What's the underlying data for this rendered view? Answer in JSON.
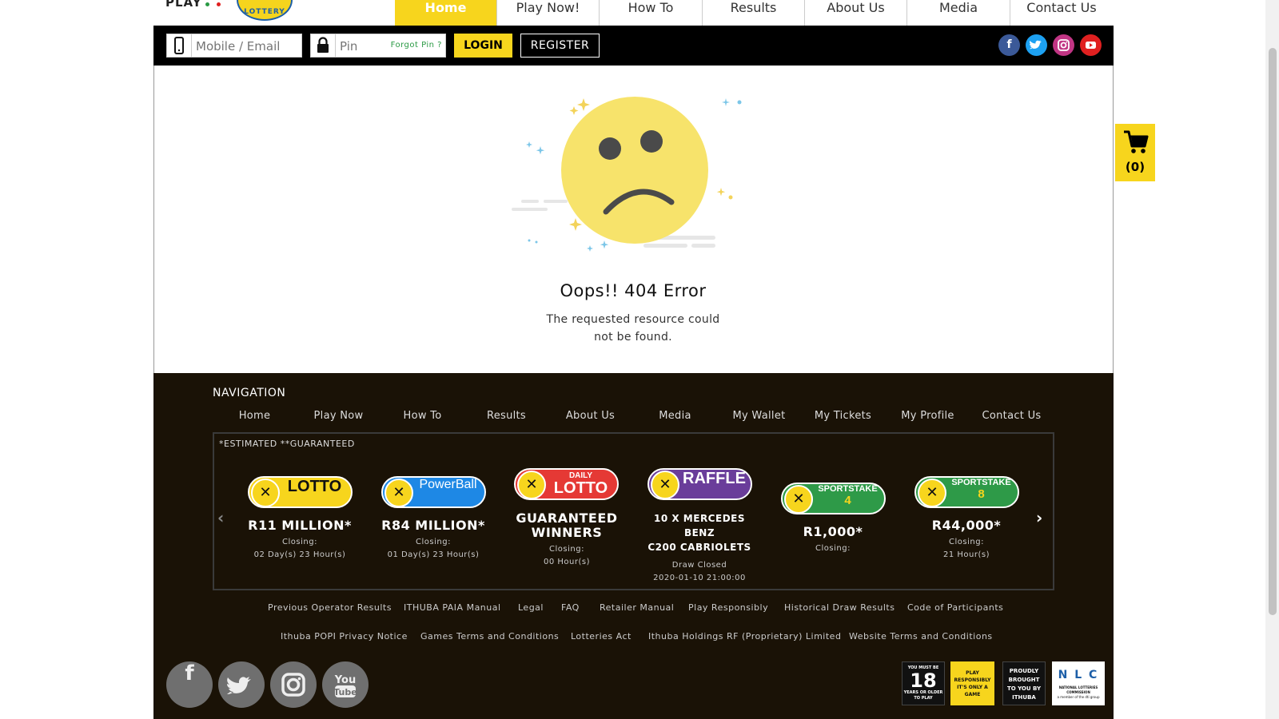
{
  "header": {
    "brand_play": "PLAY",
    "logo_text": "LOTTERY",
    "nav": [
      "Home",
      "Play Now!",
      "How To",
      "Results",
      "About Us",
      "Media",
      "Contact Us"
    ],
    "active_nav": "Home"
  },
  "login": {
    "mobile_placeholder": "Mobile / Email",
    "pin_placeholder": "Pin",
    "forgot_label": "Forgot Pin ?",
    "login_label": "LOGIN",
    "register_label": "REGISTER"
  },
  "social": {
    "icons": [
      "facebook-icon",
      "twitter-icon",
      "instagram-icon",
      "youtube-icon"
    ],
    "colors": {
      "facebook": "#3b5998",
      "twitter": "#1da1f2",
      "instagram": "#c13584",
      "youtube": "#e02020"
    }
  },
  "cart": {
    "count_label": "(0)"
  },
  "error": {
    "title": "Oops!! 404 Error",
    "message": "The requested resource could not be found."
  },
  "footer": {
    "nav_heading": "NAVIGATION",
    "nav": [
      "Home",
      "Play Now",
      "How To",
      "Results",
      "About Us",
      "Media",
      "My Wallet",
      "My Tickets",
      "My Profile",
      "Contact Us"
    ],
    "estimated_note": "*ESTIMATED **GUARANTEED",
    "games": [
      {
        "name": "LOTTO",
        "jackpot": "R11 MILLION*",
        "closing_label": "Closing:",
        "closing_value": "02 Day(s) 23 Hour(s)",
        "color": "#f7d51d"
      },
      {
        "name": "PowerBall",
        "jackpot": "R84 MILLION*",
        "closing_label": "Closing:",
        "closing_value": "01 Day(s) 23 Hour(s)",
        "color": "#1e88e5"
      },
      {
        "name_top": "DAILY",
        "name": "LOTTO",
        "jackpot_line1": "GUARANTEED",
        "jackpot_line2": "WINNERS",
        "closing_label": "Closing:",
        "closing_value": "00 Hour(s)",
        "color": "#e53935"
      },
      {
        "name": "RAFFLE",
        "jackpot_line1": "10 X MERCEDES BENZ",
        "jackpot_line2": "C200 CABRIOLETS",
        "closing_label": "Draw Closed",
        "closing_value": "2020-01-10 21:00:00",
        "color": "#6a3d9a"
      },
      {
        "name": "SPORTSTAKE",
        "number": "4",
        "jackpot": "R1,000*",
        "closing_label": "Closing:",
        "closing_value": "",
        "color": "#2e9a48"
      },
      {
        "name": "SPORTSTAKE",
        "number": "8",
        "jackpot": "R44,000*",
        "closing_label": "Closing:",
        "closing_value": "21 Hour(s)",
        "color": "#2e9a48"
      }
    ],
    "links_row1": [
      "Previous Operator Results",
      "ITHUBA PAIA Manual",
      "Legal",
      "FAQ",
      "Retailer Manual",
      "Play Responsibly",
      "Historical Draw Results",
      "Code of Participants"
    ],
    "links_row2": [
      "Ithuba POPI Privacy Notice",
      "Games Terms and Conditions",
      "Lotteries Act",
      "Ithuba Holdings RF (Proprietary) Limited",
      "Website Terms and Conditions"
    ],
    "big_social": [
      "facebook-icon",
      "twitter-icon",
      "instagram-icon",
      "youtube-icon"
    ],
    "badges": {
      "age_top": "YOU MUST BE",
      "age_num": "18",
      "age_bottom": "YEARS OR OLDER TO PLAY",
      "responsible": "PLAY RESPONSIBLY IT'S ONLY A GAME",
      "ithuba": "PROUDLY BROUGHT TO YOU BY ITHUBA",
      "nlc_letters": "N L C",
      "nlc_text": "NATIONAL LOTTERIES COMMISSION",
      "nlc_sub": "a member of the dti group"
    }
  }
}
